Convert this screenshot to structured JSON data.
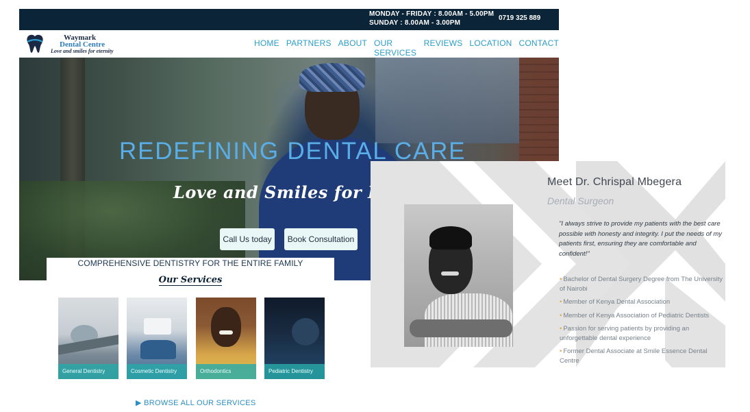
{
  "topbar": {
    "hours_weekday": "MONDAY - FRIDAY : 8.00AM - 5.00PM",
    "hours_sunday": "SUNDAY : 8.00AM - 3.00PM",
    "phone": "0719 325 889"
  },
  "logo": {
    "line1": "Waymark",
    "line2": "Dental Centre",
    "tagline": "Love and smiles for eternity"
  },
  "nav": {
    "items": [
      "HOME",
      "PARTNERS",
      "ABOUT",
      "OUR SERVICES",
      "REVIEWS",
      "LOCATION",
      "CONTACT"
    ],
    "link_color": "#2a9ec9"
  },
  "hero": {
    "title": "REDEFINING DENTAL CARE",
    "subtitle": "Love and Smiles for Eternity",
    "call_button": "Call Us today",
    "book_button": "Book Consultation"
  },
  "services": {
    "heading": "COMPREHENSIVE DENTISTRY FOR THE ENTIRE FAMILY",
    "title": "Our Services",
    "cards": [
      {
        "label": "General Dentistry"
      },
      {
        "label": "Cosmetic Dentistry"
      },
      {
        "label": "Orthodontics"
      },
      {
        "label": "Pediatric Dentistry"
      }
    ],
    "browse_link": "BROWSE ALL OUR SERVICES",
    "accent_color": "#28aaaa"
  },
  "doctor": {
    "title": "Meet Dr. Chrispal Mbegera",
    "role": "Dental Surgeon",
    "quote": "\"I always strive to provide my patients with the best care possible with honesty and integrity. I put the needs of my patients first, ensuring they are comfortable and confident!\"",
    "credentials": [
      "Bachelor of Dental Surgery Degree from The University of Nairobi",
      "Member of Kenya Dental Association",
      "Member of Kenya Association of Pediatric Dentists",
      "Passion for serving patients by providing an unforgettable dental experience",
      "Former Dental Associate at Smile Essence Dental Centre"
    ]
  },
  "colors": {
    "topbar_bg": "#0b2438",
    "hero_title": "#5aaee8",
    "bullet": "#e0a63a"
  }
}
